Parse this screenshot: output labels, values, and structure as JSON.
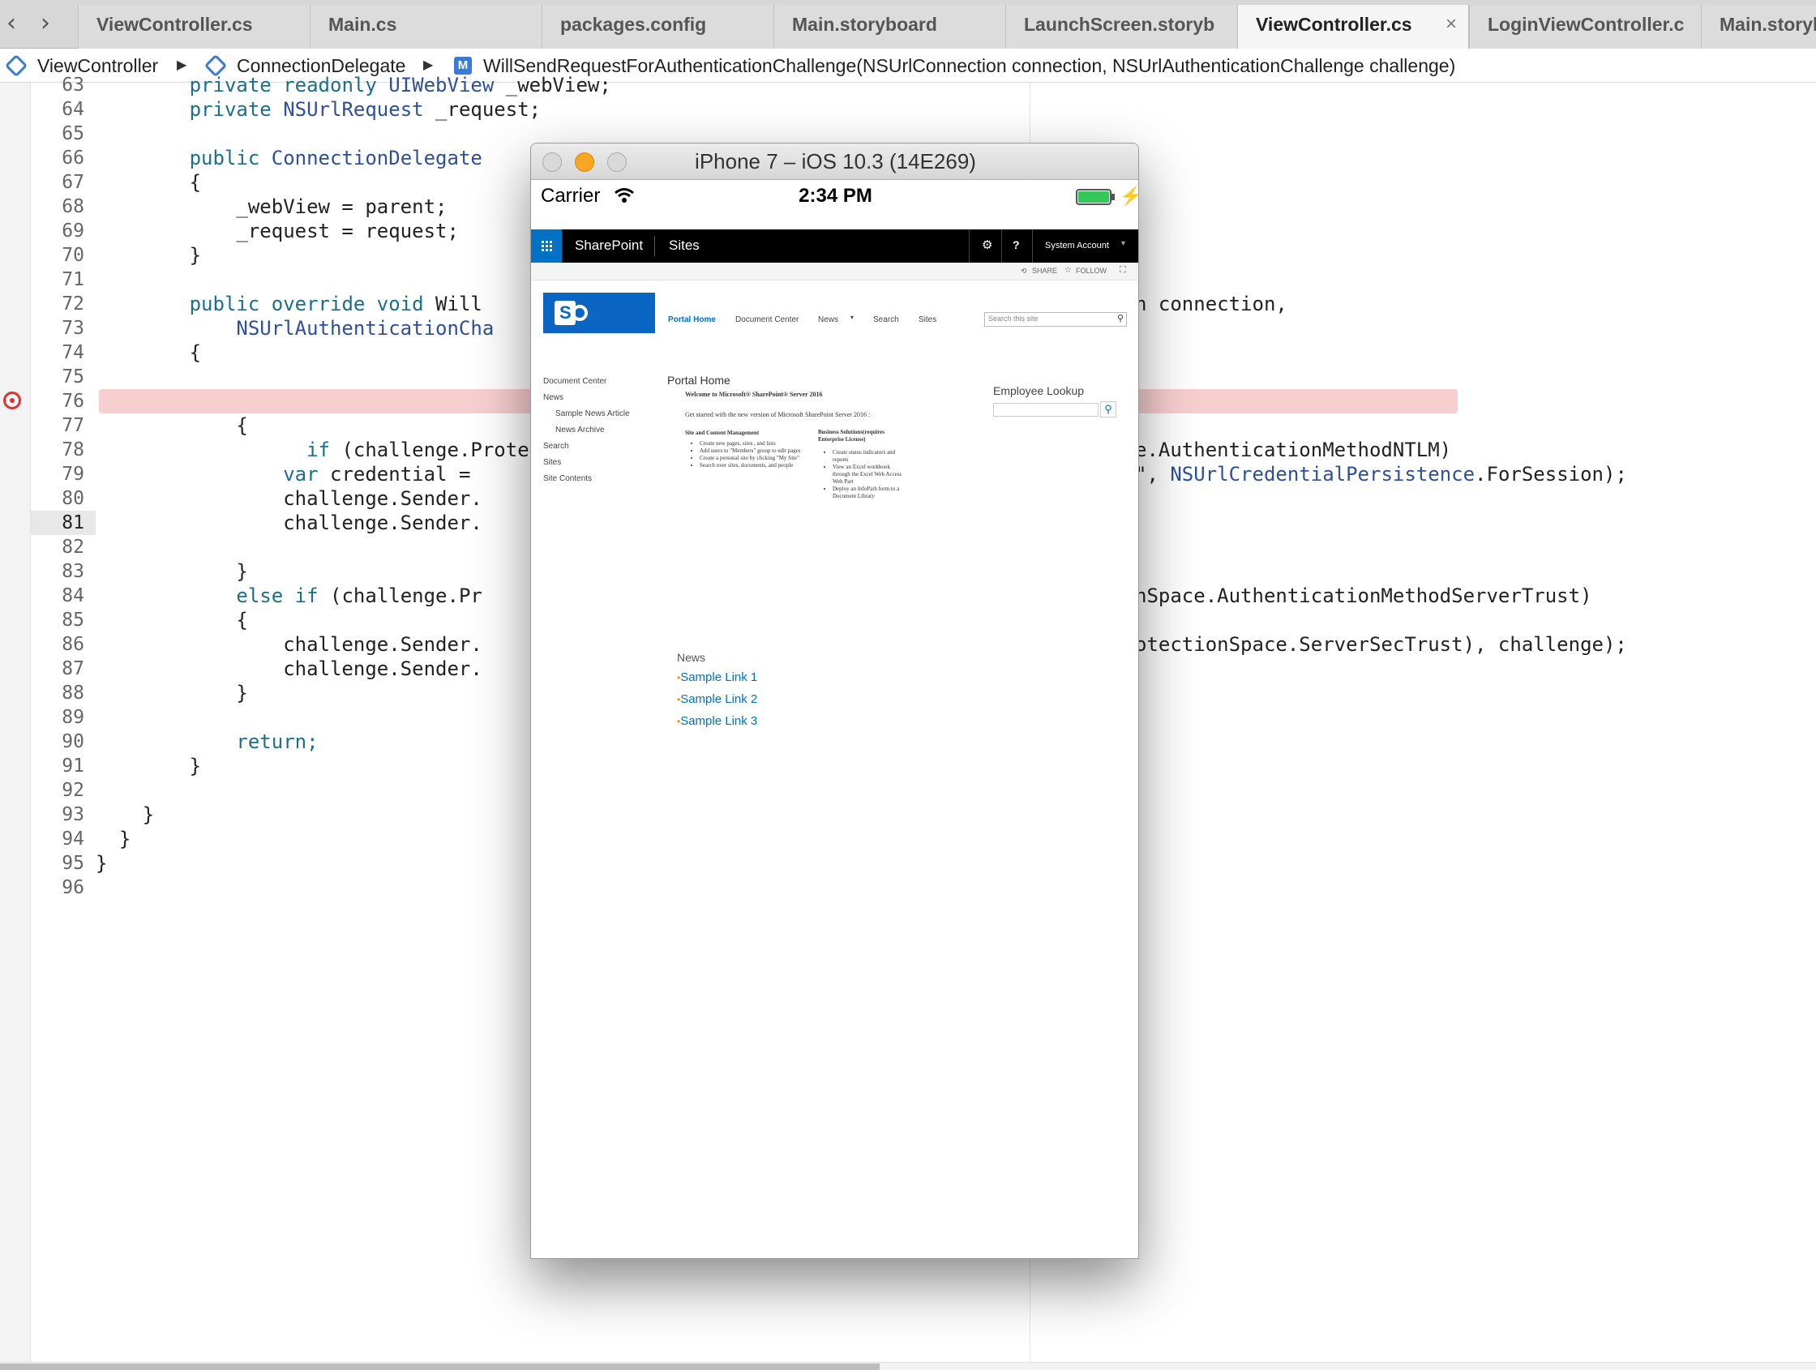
{
  "tabs": [
    {
      "label": "ViewController.cs",
      "active": false
    },
    {
      "label": "Main.cs",
      "active": false
    },
    {
      "label": "packages.config",
      "active": false
    },
    {
      "label": "Main.storyboard",
      "active": false
    },
    {
      "label": "LaunchScreen.storyb",
      "active": false
    },
    {
      "label": "ViewController.cs",
      "active": true,
      "close": "×"
    },
    {
      "label": "LoginViewController.c",
      "active": false
    },
    {
      "label": "Main.storyb",
      "active": false
    }
  ],
  "nav": {
    "back": "‹",
    "forward": "›"
  },
  "breadcrumb": {
    "item1": "ViewController",
    "item2": "ConnectionDelegate",
    "item3": "WillSendRequestForAuthenticationChallenge(NSUrlConnection connection, NSUrlAuthenticationChallenge challenge)",
    "sep": "▶",
    "m_icon": "M"
  },
  "code_lines": [
    {
      "num": "63",
      "text": "        private readonly UIWebView _webView;"
    },
    {
      "num": "64",
      "text": "        private NSUrlRequest _request;"
    },
    {
      "num": "65",
      "text": ""
    },
    {
      "num": "66",
      "text": "        public ConnectionDelegate"
    },
    {
      "num": "67",
      "text": "        {"
    },
    {
      "num": "68",
      "text": "            _webView = parent;"
    },
    {
      "num": "69",
      "text": "            _request = request;"
    },
    {
      "num": "70",
      "text": "        }"
    },
    {
      "num": "71",
      "text": ""
    },
    {
      "num": "72",
      "text": "        public override void Will",
      "right": "n connection,"
    },
    {
      "num": "73",
      "text": "            NSUrlAuthenticationCha"
    },
    {
      "num": "74",
      "text": "        {"
    },
    {
      "num": "75",
      "text": ""
    },
    {
      "num": "76",
      "text": "            if (challenge.Protect",
      "right": "e.AuthenticationMethodNTLM)",
      "breakpoint": true
    },
    {
      "num": "77",
      "text": "            {"
    },
    {
      "num": "78",
      "text": ""
    },
    {
      "num": "79",
      "text": "                var credential = ",
      "right": "\", NSUrlCredentialPersistence.ForSession);"
    },
    {
      "num": "80",
      "text": "                challenge.Sender."
    },
    {
      "num": "81",
      "text": "                challenge.Sender.",
      "current": true
    },
    {
      "num": "82",
      "text": ""
    },
    {
      "num": "83",
      "text": "            }"
    },
    {
      "num": "84",
      "text": "            else if (challenge.Pr",
      "right": "nSpace.AuthenticationMethodServerTrust)"
    },
    {
      "num": "85",
      "text": "            {"
    },
    {
      "num": "86",
      "text": "                challenge.Sender.",
      "right": "otectionSpace.ServerSecTrust), challenge);"
    },
    {
      "num": "87",
      "text": "                challenge.Sender."
    },
    {
      "num": "88",
      "text": "            }"
    },
    {
      "num": "89",
      "text": ""
    },
    {
      "num": "90",
      "text": "            return;"
    },
    {
      "num": "91",
      "text": "        }"
    },
    {
      "num": "92",
      "text": ""
    },
    {
      "num": "93",
      "text": "    }"
    },
    {
      "num": "94",
      "text": "  }"
    },
    {
      "num": "95",
      "text": "}"
    },
    {
      "num": "96",
      "text": ""
    }
  ],
  "simulator": {
    "title": "iPhone 7 – iOS 10.3 (14E269)",
    "carrier": "Carrier",
    "time": "2:34 PM",
    "battery_color": "#34c759"
  },
  "sharepoint": {
    "brand": "SharePoint",
    "sites": "Sites",
    "gear": "⚙",
    "help": "?",
    "account": "System Account",
    "account_caret": "▾",
    "share": "SHARE",
    "follow": "FOLLOW",
    "topnav": [
      "Portal Home",
      "Document Center",
      "News",
      "Search",
      "Sites"
    ],
    "news_caret": "▾",
    "search_placeholder": "Search this site",
    "quicklaunch": [
      {
        "label": "Document Center",
        "indent": false
      },
      {
        "label": "News",
        "indent": false
      },
      {
        "label": "Sample News Article",
        "indent": true
      },
      {
        "label": "News Archive",
        "indent": true
      },
      {
        "label": "Search",
        "indent": false
      },
      {
        "label": "Sites",
        "indent": false
      },
      {
        "label": "Site Contents",
        "indent": false
      }
    ],
    "page_title": "Portal Home",
    "welcome_title": "Welcome to Microsoft® SharePoint® Server 2016",
    "welcome_text": "Get started with the new version of Microsoft SharePoint Server 2016 :",
    "col1_title": "Site and Content Management",
    "col1_items": [
      "Create new pages, sites , and lists",
      "Add users to \"Members\" group to edit pages",
      "Create a personal site by clicking \"My Site\"",
      "Search over sites, documents, and people"
    ],
    "col2_title": "Business Solutions(requires Enterprise License)",
    "col2_items": [
      "Create status indicators and reports",
      "View an Excel workbook through the Excel Web Access Web Part",
      "Deploy an InfoPath form to a Document Library"
    ],
    "employee_lookup": "Employee Lookup",
    "news_heading": "News",
    "news_links": [
      "Sample Link 1",
      "Sample Link 2",
      "Sample Link 3"
    ],
    "brand_blue": "#0072c6"
  }
}
